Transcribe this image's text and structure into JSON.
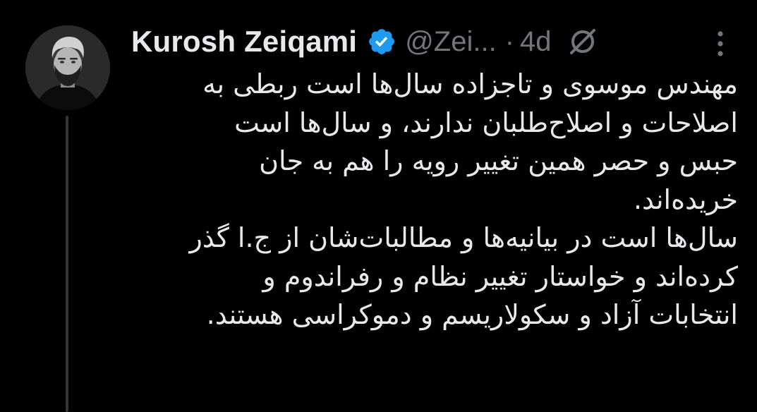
{
  "tweet": {
    "display_name": "Kurosh Zeiqami",
    "handle": "@Zei...",
    "separator": "·",
    "time": "4d",
    "text_lines": [
      "مهندس موسوی و تاجزاده سال‌ها است ربطی به",
      "اصلاحات و اصلاح‌طلبان ندارند، و سال‌ها است",
      "حبس و حصر همین تغییر رویه را هم به جان",
      "خریده‌اند.",
      "سال‌ها است در بیانیه‌ها و مطالبات‌شان از ج.ا گذر",
      "کرده‌اند و خواستار تغییر نظام و رفراندوم و",
      "انتخابات آزاد و سکولاریسم و دموکراسی هستند."
    ]
  },
  "icons": {
    "verified": "verified-badge-icon",
    "grok": "grok-icon",
    "more": "more-options-icon"
  },
  "colors": {
    "background": "#000000",
    "text": "#e7e9ea",
    "secondary": "#71767b",
    "verified": "#1d9bf0",
    "thread_line": "#333639"
  }
}
